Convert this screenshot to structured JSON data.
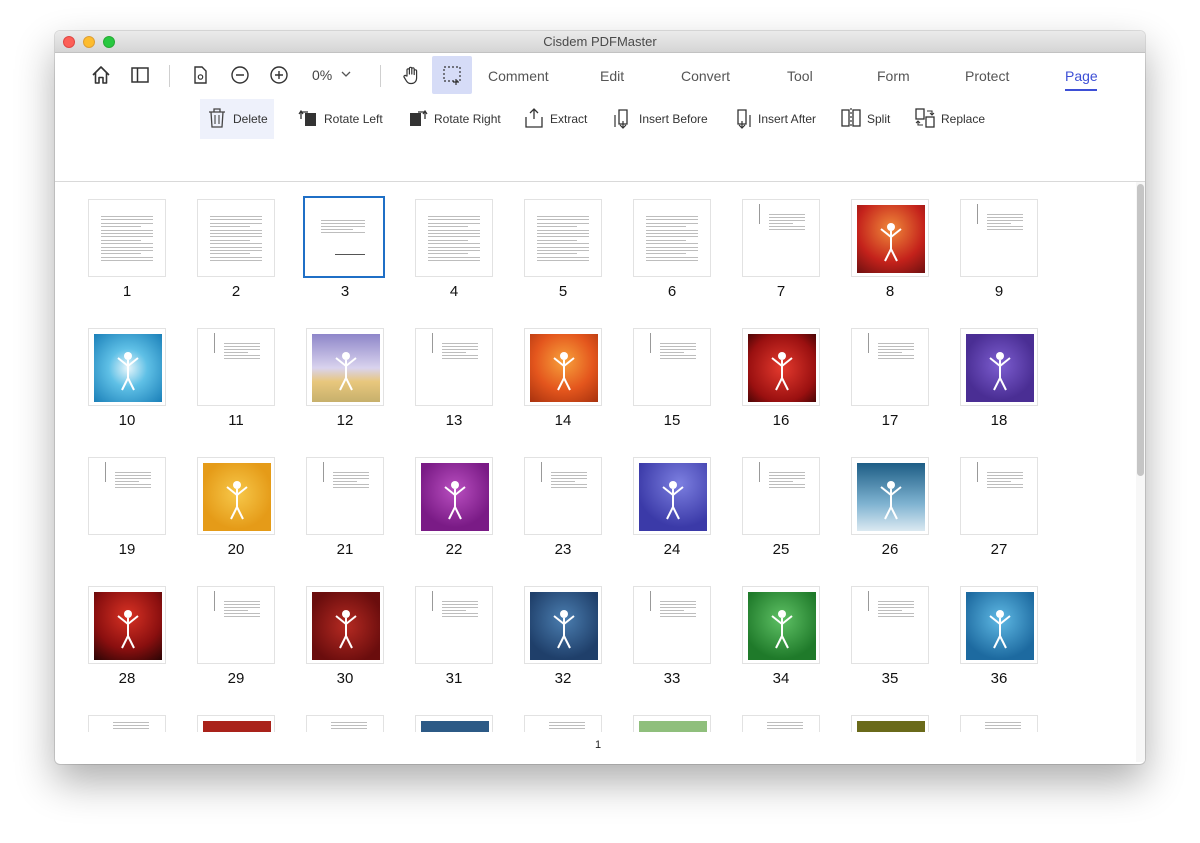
{
  "window": {
    "title": "Cisdem PDFMaster"
  },
  "toolbar": {
    "zoom": "0%",
    "tabs": [
      {
        "label": "Comment",
        "active": false
      },
      {
        "label": "Edit",
        "active": false
      },
      {
        "label": "Convert",
        "active": false
      },
      {
        "label": "Tool",
        "active": false
      },
      {
        "label": "Form",
        "active": false
      },
      {
        "label": "Protect",
        "active": false
      },
      {
        "label": "Page",
        "active": true
      }
    ]
  },
  "page_tools": {
    "delete": "Delete",
    "rotate_left": "Rotate Left",
    "rotate_right": "Rotate Right",
    "extract": "Extract",
    "insert_before": "Insert Before",
    "insert_after": "Insert After",
    "split": "Split",
    "replace": "Replace"
  },
  "thumbnails": {
    "selected": 3,
    "rows": [
      [
        "1",
        "2",
        "3",
        "4",
        "5",
        "6",
        "7",
        "8",
        "9"
      ],
      [
        "10",
        "11",
        "12",
        "13",
        "14",
        "15",
        "16",
        "17",
        "18"
      ],
      [
        "19",
        "20",
        "21",
        "22",
        "23",
        "24",
        "25",
        "26",
        "27"
      ],
      [
        "28",
        "29",
        "30",
        "31",
        "32",
        "33",
        "34",
        "35",
        "36"
      ]
    ]
  },
  "status": {
    "current_page": "1"
  },
  "colors": {
    "accent": "#3d4fd6",
    "selection": "#1f6fc6"
  },
  "icons": [
    "home-icon",
    "sidebar-icon",
    "page-view-icon",
    "zoom-out-icon",
    "zoom-in-icon",
    "chevron-down-icon",
    "hand-tool-icon",
    "select-tool-icon",
    "trash-icon",
    "rotate-left-icon",
    "rotate-right-icon",
    "extract-icon",
    "insert-before-icon",
    "insert-after-icon",
    "split-icon",
    "replace-icon"
  ]
}
